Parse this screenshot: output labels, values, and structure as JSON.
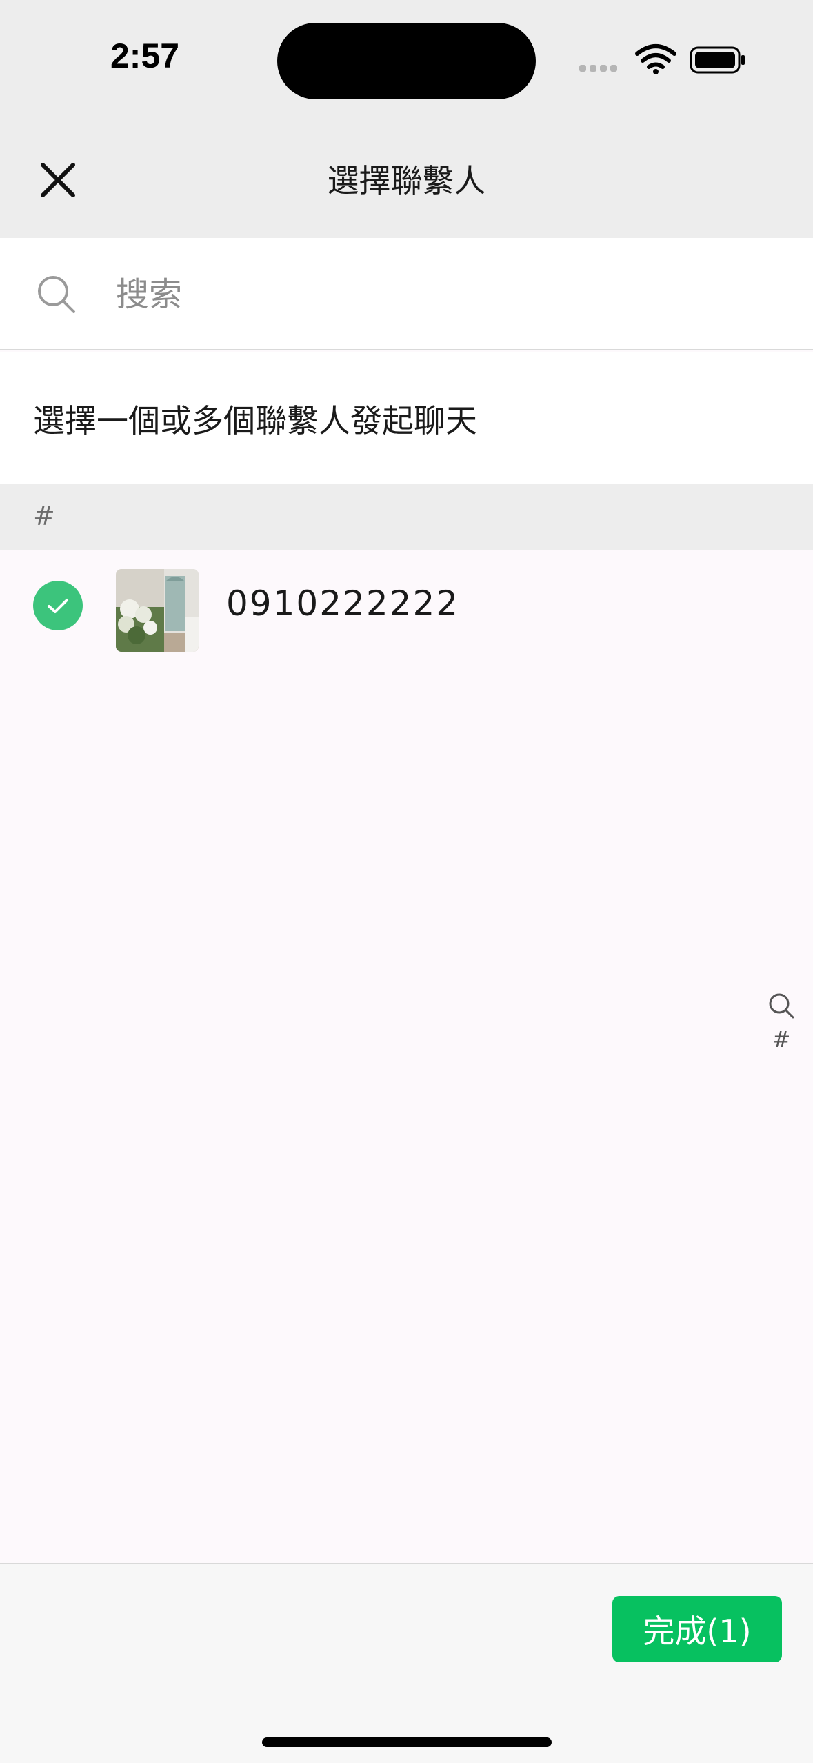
{
  "status_bar": {
    "time": "2:57"
  },
  "header": {
    "title": "選擇聯繫人",
    "close_icon": "close-icon"
  },
  "search": {
    "placeholder": "搜索",
    "value": ""
  },
  "hint": "選擇一個或多個聯繫人發起聊天",
  "sections": [
    {
      "letter": "#",
      "contacts": [
        {
          "name": "0910222222",
          "selected": true
        }
      ]
    }
  ],
  "index_bar": {
    "search_icon": "search-icon",
    "letters": [
      "#"
    ]
  },
  "footer": {
    "done_label": "完成(1)"
  },
  "colors": {
    "accent": "#07c160",
    "check": "#3cc47c",
    "header_bg": "#ededed",
    "list_bg": "#fdf9fc"
  }
}
